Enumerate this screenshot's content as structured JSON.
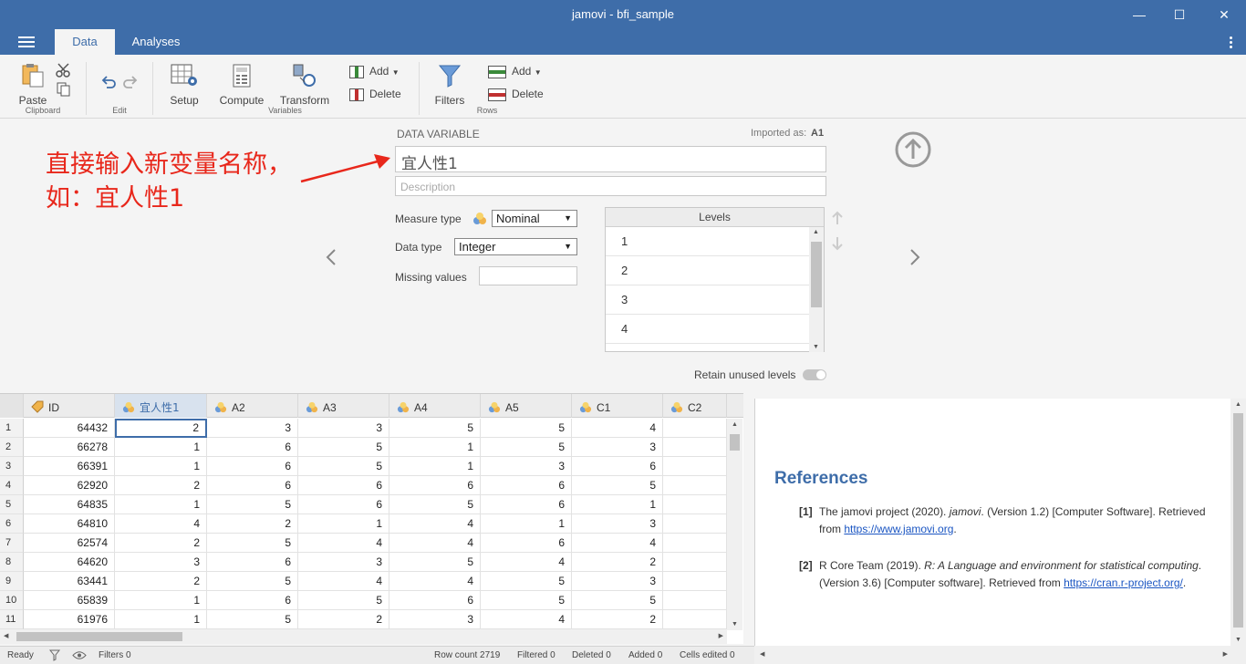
{
  "window": {
    "title": "jamovi - bfi_sample",
    "minimize": "—",
    "maximize": "☐",
    "close": "✕"
  },
  "tabs": {
    "data": "Data",
    "analyses": "Analyses"
  },
  "ribbon": {
    "paste": "Paste",
    "clipboard_group": "Clipboard",
    "edit_group": "Edit",
    "setup": "Setup",
    "compute": "Compute",
    "transform": "Transform",
    "var_add": "Add",
    "var_delete": "Delete",
    "variables_group": "Variables",
    "filters": "Filters",
    "row_add": "Add",
    "row_delete": "Delete",
    "rows_group": "Rows"
  },
  "editor": {
    "section_label": "DATA VARIABLE",
    "imported_as_label": "Imported as:",
    "imported_as_value": "A1",
    "name_value": "宜人性1",
    "description_placeholder": "Description",
    "measure_type_label": "Measure type",
    "measure_type_value": "Nominal",
    "data_type_label": "Data type",
    "data_type_value": "Integer",
    "missing_values_label": "Missing values",
    "levels_header": "Levels",
    "levels": [
      "1",
      "2",
      "3",
      "4"
    ],
    "retain_unused_label": "Retain unused levels",
    "retain_unused": false,
    "annotation_line1": "直接输入新变量名称，",
    "annotation_line2": "如：宜人性1"
  },
  "colors": {
    "accent": "#3e6da9",
    "annotation": "#e8271b"
  },
  "sheet": {
    "columns": [
      "ID",
      "宜人性1",
      "A2",
      "A3",
      "A4",
      "A5",
      "C1",
      "C2"
    ],
    "row_numbers": [
      "1",
      "2",
      "3",
      "4",
      "5",
      "6",
      "7",
      "8",
      "9",
      "10",
      "11"
    ],
    "rows": [
      [
        "64432",
        "2",
        "3",
        "3",
        "5",
        "5",
        "4"
      ],
      [
        "66278",
        "1",
        "6",
        "5",
        "1",
        "5",
        "3"
      ],
      [
        "66391",
        "1",
        "6",
        "5",
        "1",
        "3",
        "6"
      ],
      [
        "62920",
        "2",
        "6",
        "6",
        "6",
        "6",
        "5"
      ],
      [
        "64835",
        "1",
        "5",
        "6",
        "5",
        "6",
        "1"
      ],
      [
        "64810",
        "4",
        "2",
        "1",
        "4",
        "1",
        "3"
      ],
      [
        "62574",
        "2",
        "5",
        "4",
        "4",
        "6",
        "4"
      ],
      [
        "64620",
        "3",
        "6",
        "3",
        "5",
        "4",
        "2"
      ],
      [
        "63441",
        "2",
        "5",
        "4",
        "4",
        "5",
        "3"
      ],
      [
        "65839",
        "1",
        "6",
        "5",
        "6",
        "5",
        "5"
      ],
      [
        "61976",
        "1",
        "5",
        "2",
        "3",
        "4",
        "2"
      ]
    ]
  },
  "results": {
    "title": "References",
    "refs": [
      {
        "num": "[1]",
        "pre": "The jamovi project (2020). ",
        "italic": "jamovi",
        "post": ". (Version 1.2) [Computer Software]. Retrieved from ",
        "link": "https://www.jamovi.org",
        "end": "."
      },
      {
        "num": "[2]",
        "pre": "R Core Team (2019). ",
        "italic": "R: A Language and environment for statistical computing",
        "post": ". (Version 3.6) [Computer software]. Retrieved from ",
        "link": "https://cran.r-project.org/",
        "end": "."
      }
    ]
  },
  "status": {
    "ready": "Ready",
    "filters": "Filters 0",
    "row_count": "Row count 2719",
    "filtered": "Filtered 0",
    "deleted": "Deleted 0",
    "added": "Added 0",
    "cells_edited": "Cells edited 0"
  }
}
